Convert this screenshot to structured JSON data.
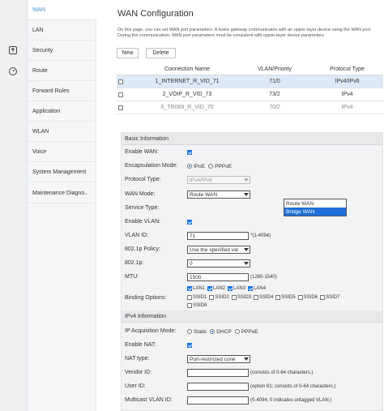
{
  "rail": {
    "icons": [
      "upload-box-icon",
      "dashboard-icon"
    ]
  },
  "nav": {
    "items": [
      {
        "label": "WAN",
        "active": true
      },
      {
        "label": "LAN"
      },
      {
        "label": "Security"
      },
      {
        "label": "Route"
      },
      {
        "label": "Forward Rules"
      },
      {
        "label": "Application"
      },
      {
        "label": "WLAN"
      },
      {
        "label": "Voice"
      },
      {
        "label": "System Management"
      },
      {
        "label": "Maintenance Diagno.."
      }
    ]
  },
  "page": {
    "title": "WAN Configuration",
    "description": "On this page, you can set WAN port parameters. A home gateway communicates with an upper-layer device using the WAN port. During the communication, WAN port parameters must be consistent with upper-layer device parameters."
  },
  "toolbar": {
    "new_label": "New",
    "delete_label": "Delete"
  },
  "table": {
    "headers": [
      "Connection Name",
      "VLAN/Priority",
      "Protocol Type"
    ],
    "rows": [
      {
        "name": "1_INTERNET_R_VID_71",
        "vlan": "71/0",
        "protocol": "IPv4/IPv6",
        "selected": true
      },
      {
        "name": "2_VOIP_R_VID_73",
        "vlan": "73/2",
        "protocol": "IPv4"
      },
      {
        "name": "6_TR069_R_VID_70",
        "vlan": "70/2",
        "protocol": "IPv4",
        "dim": true
      }
    ]
  },
  "basic": {
    "title": "Basic Information",
    "enable_wan": "Enable WAN:",
    "encapsulation": "Encapsulation Mode:",
    "encap_ipoe": "IPoE",
    "encap_pppoe": "PPPoE",
    "protocol_type": "Protocol Type:",
    "protocol_value": "IPv4/IPv6",
    "wan_mode": "WAN Mode:",
    "wan_mode_value": "Route WAN",
    "wan_mode_options": [
      "Route WAN",
      "Bridge WAN"
    ],
    "service_type": "Service Type:",
    "enable_vlan": "Enable VLAN:",
    "vlan_id": "VLAN ID:",
    "vlan_id_value": "71",
    "vlan_id_hint": "*(1-4094)",
    "policy_8021p": "802.1p Policy:",
    "policy_value": "Use the specified val",
    "p8021": "802.1p:",
    "p8021_value": "0",
    "mtu": "MTU:",
    "mtu_value": "1500",
    "mtu_hint": "(1280-1540)",
    "binding": "Binding Options:",
    "binding_lan": [
      "LAN1",
      "LAN2",
      "LAN3",
      "LAN4"
    ],
    "binding_ssid": [
      "SSID1",
      "SSID2",
      "SSID3",
      "SSID4",
      "SSID5",
      "SSID6",
      "SSID7"
    ],
    "binding_ssid8": "SSID8"
  },
  "ipv4": {
    "title": "IPv4 Information",
    "acq_mode": "IP Acquisition Mode:",
    "acq_static": "Static",
    "acq_dhcp": "DHCP",
    "acq_pppoe": "PPPoE",
    "enable_nat": "Enable NAT:",
    "nat_type": "NAT type:",
    "nat_value": "Port-restricted cone",
    "vendor_id": "Vendor ID:",
    "vendor_hint": "(consists of 0-64 characters.)",
    "user_id": "User ID:",
    "user_hint": "(option 61; consists of 0-64 characters.)",
    "mcast_vlan": "Multicast VLAN ID:",
    "mcast_hint": "(0-4094; 0 indicates untagged VLAN.)"
  },
  "colors": {
    "accent": "#1a73e8",
    "selected_row": "#dce9f7",
    "active_nav_text": "#4a90d9"
  }
}
